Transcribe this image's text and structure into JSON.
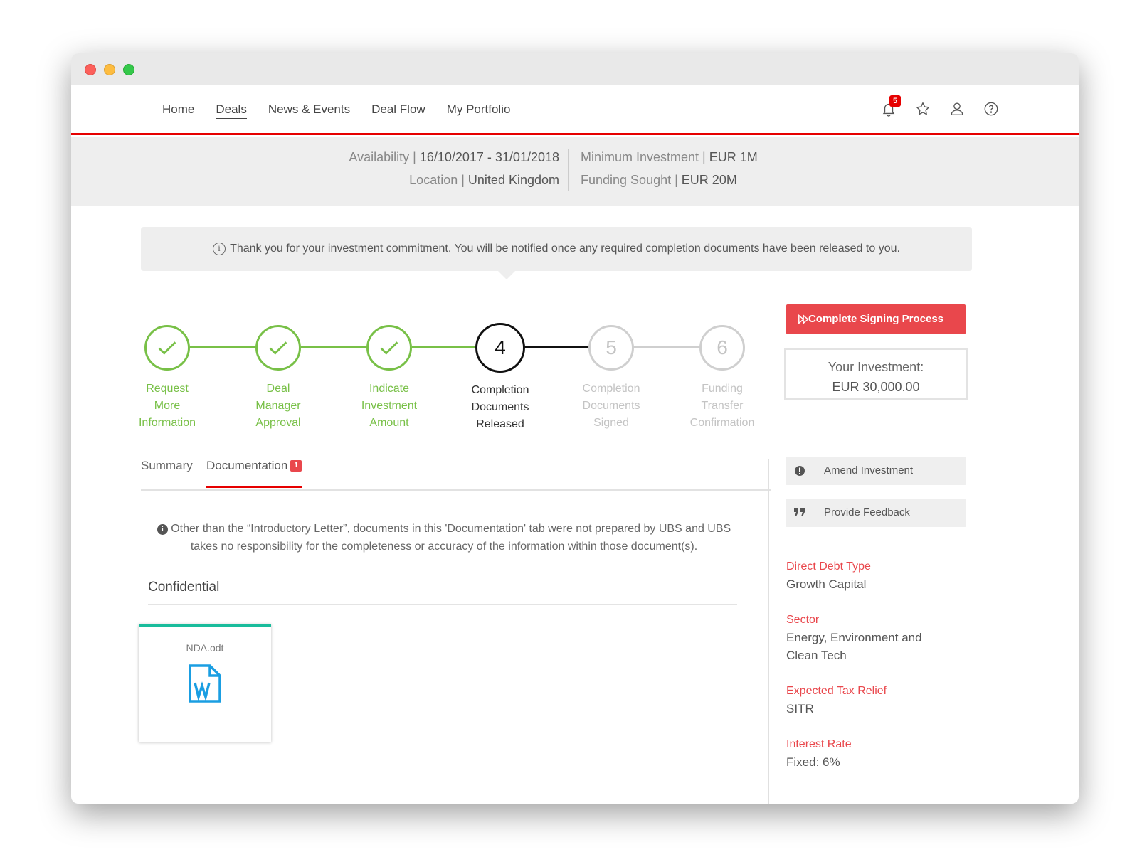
{
  "nav": {
    "items": [
      "Home",
      "Deals",
      "News & Events",
      "Deal Flow",
      "My Portfolio"
    ],
    "active": "Deals",
    "notification_count": "5"
  },
  "info": {
    "availability_label": "Availability |",
    "availability_value": "16/10/2017 - 31/01/2018",
    "location_label": "Location |",
    "location_value": "United Kingdom",
    "min_investment_label": "Minimum Investment |",
    "min_investment_value": "EUR 1M",
    "funding_label": "Funding Sought |",
    "funding_value": "EUR 20M"
  },
  "notice": "Thank you for your investment commitment. You will be notified once any required completion documents have been released to you.",
  "steps": [
    {
      "number": "1",
      "label_lines": [
        "Request",
        "More",
        "Information"
      ],
      "status": "done"
    },
    {
      "number": "2",
      "label_lines": [
        "Deal",
        "Manager",
        "Approval"
      ],
      "status": "done"
    },
    {
      "number": "3",
      "label_lines": [
        "Indicate",
        "Investment",
        "Amount"
      ],
      "status": "done"
    },
    {
      "number": "4",
      "label_lines": [
        "Completion",
        "Documents",
        "Released"
      ],
      "status": "current"
    },
    {
      "number": "5",
      "label_lines": [
        "Completion",
        "Documents",
        "Signed"
      ],
      "status": "todo"
    },
    {
      "number": "6",
      "label_lines": [
        "Funding",
        "Transfer",
        "Confirmation"
      ],
      "status": "todo"
    }
  ],
  "sign_button": "Complete Signing Process",
  "investment": {
    "label": "Your Investment:",
    "amount": "EUR 30,000.00"
  },
  "tabs": {
    "summary": "Summary",
    "documentation": "Documentation",
    "documentation_badge": "1"
  },
  "disclaimer": "Other than the “Introductory Letter”, documents in this 'Documentation' tab were not prepared by UBS and UBS takes no responsibility for the completeness or accuracy of the information within those document(s).",
  "section_title": "Confidential",
  "document": {
    "name": "NDA.odt",
    "icon": "word-document-icon"
  },
  "sidebar": {
    "amend": "Amend Investment",
    "feedback": "Provide Feedback",
    "details": [
      {
        "label": "Direct Debt Type",
        "value": "Growth Capital"
      },
      {
        "label": "Sector",
        "value": "Energy, Environment and Clean Tech"
      },
      {
        "label": "Expected Tax Relief",
        "value": "SITR"
      },
      {
        "label": "Interest Rate",
        "value": "Fixed: 6%"
      }
    ]
  },
  "colors": {
    "accent": "#e60000",
    "complete": "#78c047",
    "button": "#e9474c",
    "doc_accent": "#1abc9c",
    "word_blue": "#1a9ee2"
  }
}
